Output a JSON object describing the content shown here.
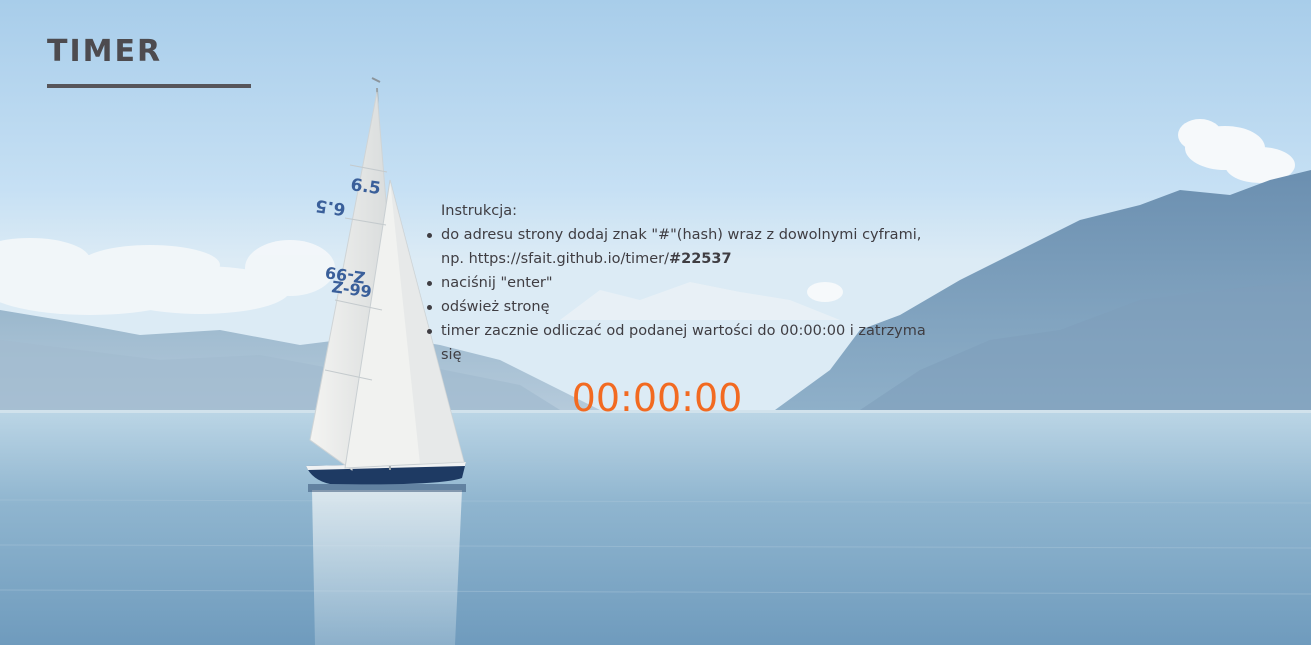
{
  "app": {
    "title": "TIMER"
  },
  "instructions": {
    "heading": "Instrukcja:",
    "items": [
      {
        "text_line1": "do adresu strony dodaj znak \"#\"(hash) wraz z dowolnymi cyframi,",
        "text_line2_prefix": "np. https://sfait.github.io/timer/",
        "text_line2_bold": "#22537"
      },
      {
        "text": "naciśnij \"enter\""
      },
      {
        "text": "odśwież stronę"
      },
      {
        "text": "timer zacznie odliczać od podanej wartości do 00:00:00 i zatrzyma się"
      }
    ]
  },
  "timer": {
    "display": "00:00:00"
  },
  "colors": {
    "accent": "#f26a21",
    "title": "#4d4b4f",
    "text": "#3f3d42"
  },
  "background": {
    "icon": "sailboat-lake-mountains-photo"
  },
  "sail_markings": {
    "upper_a": "6.5",
    "upper_b": "6.5",
    "lower_a": "Z-99",
    "lower_b": "Z-99"
  }
}
